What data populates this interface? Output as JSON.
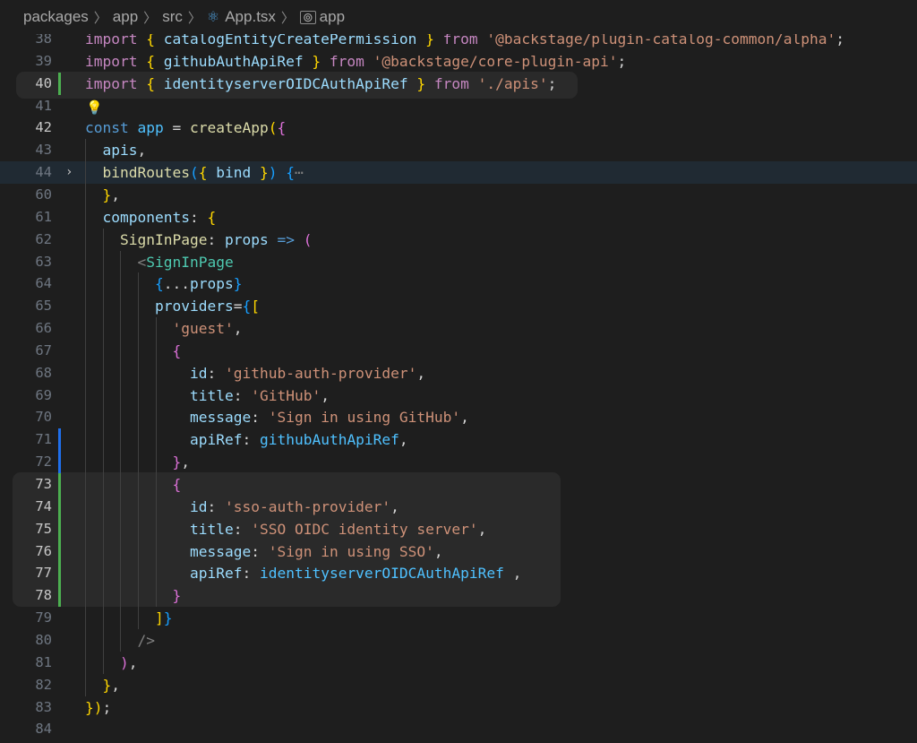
{
  "breadcrumb": {
    "items": [
      "packages",
      "app",
      "src",
      "App.tsx",
      "app"
    ],
    "file_icon": "react-icon",
    "symbol_icon": "module-symbol-icon"
  },
  "lines": [
    {
      "n": "38",
      "t": "import { catalogEntityCreatePermission } from '@backstage/plugin-catalog-common/alpha';"
    },
    {
      "n": "39",
      "t": "import { githubAuthApiRef } from '@backstage/core-plugin-api';"
    },
    {
      "n": "40",
      "t": "import { identityserverOIDCAuthApiRef } from './apis';"
    },
    {
      "n": "41",
      "t": ""
    },
    {
      "n": "42",
      "t": "const app = createApp({"
    },
    {
      "n": "43",
      "t": "  apis,"
    },
    {
      "n": "44",
      "t": "  bindRoutes({ bind }) {⋯"
    },
    {
      "n": "60",
      "t": "  },"
    },
    {
      "n": "61",
      "t": "  components: {"
    },
    {
      "n": "62",
      "t": "    SignInPage: props => ("
    },
    {
      "n": "63",
      "t": "      <SignInPage"
    },
    {
      "n": "64",
      "t": "        {...props}"
    },
    {
      "n": "65",
      "t": "        providers={["
    },
    {
      "n": "66",
      "t": "          'guest',"
    },
    {
      "n": "67",
      "t": "          {"
    },
    {
      "n": "68",
      "t": "            id: 'github-auth-provider',"
    },
    {
      "n": "69",
      "t": "            title: 'GitHub',"
    },
    {
      "n": "70",
      "t": "            message: 'Sign in using GitHub',"
    },
    {
      "n": "71",
      "t": "            apiRef: githubAuthApiRef,"
    },
    {
      "n": "72",
      "t": "          },"
    },
    {
      "n": "73",
      "t": "          {"
    },
    {
      "n": "74",
      "t": "            id: 'sso-auth-provider',"
    },
    {
      "n": "75",
      "t": "            title: 'SSO OIDC identity server',"
    },
    {
      "n": "76",
      "t": "            message: 'Sign in using SSO',"
    },
    {
      "n": "77",
      "t": "            apiRef: identityserverOIDCAuthApiRef ,"
    },
    {
      "n": "78",
      "t": "          }"
    },
    {
      "n": "79",
      "t": "        ]}"
    },
    {
      "n": "80",
      "t": "      />"
    },
    {
      "n": "81",
      "t": "    ),"
    },
    {
      "n": "82",
      "t": "  },"
    },
    {
      "n": "83",
      "t": "});"
    },
    {
      "n": "84",
      "t": ""
    }
  ],
  "colors": {
    "background": "#1e1e1e",
    "added_marker": "#4caf50",
    "modified_marker": "#1f6feb",
    "keyword": "#c586c0",
    "string": "#ce9178",
    "variable": "#9cdcfe"
  }
}
